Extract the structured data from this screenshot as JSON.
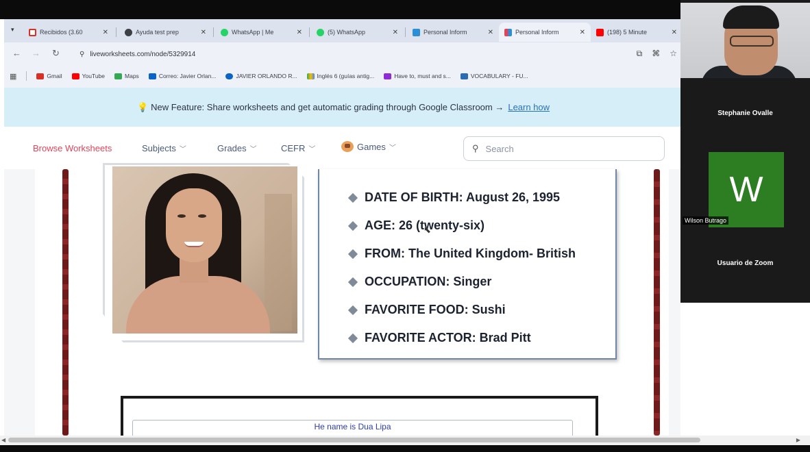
{
  "browser": {
    "tabs": [
      {
        "label": "Recibidos (3.60",
        "icon_color": "#d93025"
      },
      {
        "label": "Ayuda test prep",
        "icon_color": "#3c4043"
      },
      {
        "label": "WhatsApp | Me",
        "icon_color": "#25d366"
      },
      {
        "label": "(5) WhatsApp",
        "icon_color": "#25d366"
      },
      {
        "label": "Personal Inform",
        "icon_color": "#2b8fd8"
      },
      {
        "label": "Personal Inform",
        "icon_color": "#e0445a"
      },
      {
        "label": "(198) 5 Minute",
        "icon_color": "#ff0000"
      }
    ],
    "url": "liveworksheets.com/node/5329914",
    "bookmarks": [
      {
        "label": "Gmail",
        "icon_color": "#d93025"
      },
      {
        "label": "YouTube",
        "icon_color": "#ff0000"
      },
      {
        "label": "Maps",
        "icon_color": "#34a853"
      },
      {
        "label": "Correo: Javier Orlan...",
        "icon_color": "#0a64c8"
      },
      {
        "label": "JAVIER ORLANDO R...",
        "icon_color": "#0a64c8"
      },
      {
        "label": "Inglés 6 (guías antig...",
        "icon_color": "#fbbc04"
      },
      {
        "label": "Have to, must and s...",
        "icon_color": "#8e2bd6"
      },
      {
        "label": "VOCABULARY - FU...",
        "icon_color": "#2b6cb0"
      }
    ]
  },
  "banner": {
    "text": "New Feature: Share worksheets and get automatic grading through Google Classroom →",
    "link": "Learn how"
  },
  "nav": {
    "browse": "Browse Worksheets",
    "subjects": "Subjects",
    "grades": "Grades",
    "cefr": "CEFR",
    "games": "Games",
    "search_placeholder": "Search"
  },
  "worksheet": {
    "items": [
      "DATE OF BIRTH: August 26, 1995",
      "AGE: 26 (twenty-six)",
      "FROM: The United Kingdom- British",
      "OCCUPATION: Singer",
      "FAVORITE FOOD: Sushi",
      "FAVORITE ACTOR: Brad Pitt"
    ],
    "answer": "He name is Dua Lipa"
  },
  "zoom": {
    "participant1": "Stephanie Ovalle",
    "avatar_letter": "W",
    "participant2": "Wilson Butrago",
    "participant3": "Usuario de Zoom",
    "avatar_color": "#2d7d23"
  }
}
